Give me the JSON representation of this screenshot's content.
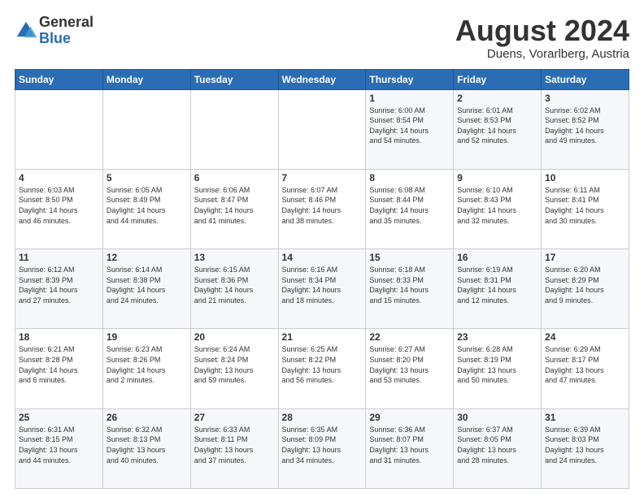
{
  "logo": {
    "general": "General",
    "blue": "Blue"
  },
  "title": "August 2024",
  "location": "Duens, Vorarlberg, Austria",
  "days_of_week": [
    "Sunday",
    "Monday",
    "Tuesday",
    "Wednesday",
    "Thursday",
    "Friday",
    "Saturday"
  ],
  "weeks": [
    [
      {
        "day": "",
        "info": ""
      },
      {
        "day": "",
        "info": ""
      },
      {
        "day": "",
        "info": ""
      },
      {
        "day": "",
        "info": ""
      },
      {
        "day": "1",
        "info": "Sunrise: 6:00 AM\nSunset: 8:54 PM\nDaylight: 14 hours\nand 54 minutes."
      },
      {
        "day": "2",
        "info": "Sunrise: 6:01 AM\nSunset: 8:53 PM\nDaylight: 14 hours\nand 52 minutes."
      },
      {
        "day": "3",
        "info": "Sunrise: 6:02 AM\nSunset: 8:52 PM\nDaylight: 14 hours\nand 49 minutes."
      }
    ],
    [
      {
        "day": "4",
        "info": "Sunrise: 6:03 AM\nSunset: 8:50 PM\nDaylight: 14 hours\nand 46 minutes."
      },
      {
        "day": "5",
        "info": "Sunrise: 6:05 AM\nSunset: 8:49 PM\nDaylight: 14 hours\nand 44 minutes."
      },
      {
        "day": "6",
        "info": "Sunrise: 6:06 AM\nSunset: 8:47 PM\nDaylight: 14 hours\nand 41 minutes."
      },
      {
        "day": "7",
        "info": "Sunrise: 6:07 AM\nSunset: 8:46 PM\nDaylight: 14 hours\nand 38 minutes."
      },
      {
        "day": "8",
        "info": "Sunrise: 6:08 AM\nSunset: 8:44 PM\nDaylight: 14 hours\nand 35 minutes."
      },
      {
        "day": "9",
        "info": "Sunrise: 6:10 AM\nSunset: 8:43 PM\nDaylight: 14 hours\nand 32 minutes."
      },
      {
        "day": "10",
        "info": "Sunrise: 6:11 AM\nSunset: 8:41 PM\nDaylight: 14 hours\nand 30 minutes."
      }
    ],
    [
      {
        "day": "11",
        "info": "Sunrise: 6:12 AM\nSunset: 8:39 PM\nDaylight: 14 hours\nand 27 minutes."
      },
      {
        "day": "12",
        "info": "Sunrise: 6:14 AM\nSunset: 8:38 PM\nDaylight: 14 hours\nand 24 minutes."
      },
      {
        "day": "13",
        "info": "Sunrise: 6:15 AM\nSunset: 8:36 PM\nDaylight: 14 hours\nand 21 minutes."
      },
      {
        "day": "14",
        "info": "Sunrise: 6:16 AM\nSunset: 8:34 PM\nDaylight: 14 hours\nand 18 minutes."
      },
      {
        "day": "15",
        "info": "Sunrise: 6:18 AM\nSunset: 8:33 PM\nDaylight: 14 hours\nand 15 minutes."
      },
      {
        "day": "16",
        "info": "Sunrise: 6:19 AM\nSunset: 8:31 PM\nDaylight: 14 hours\nand 12 minutes."
      },
      {
        "day": "17",
        "info": "Sunrise: 6:20 AM\nSunset: 8:29 PM\nDaylight: 14 hours\nand 9 minutes."
      }
    ],
    [
      {
        "day": "18",
        "info": "Sunrise: 6:21 AM\nSunset: 8:28 PM\nDaylight: 14 hours\nand 6 minutes."
      },
      {
        "day": "19",
        "info": "Sunrise: 6:23 AM\nSunset: 8:26 PM\nDaylight: 14 hours\nand 2 minutes."
      },
      {
        "day": "20",
        "info": "Sunrise: 6:24 AM\nSunset: 8:24 PM\nDaylight: 13 hours\nand 59 minutes."
      },
      {
        "day": "21",
        "info": "Sunrise: 6:25 AM\nSunset: 8:22 PM\nDaylight: 13 hours\nand 56 minutes."
      },
      {
        "day": "22",
        "info": "Sunrise: 6:27 AM\nSunset: 8:20 PM\nDaylight: 13 hours\nand 53 minutes."
      },
      {
        "day": "23",
        "info": "Sunrise: 6:28 AM\nSunset: 8:19 PM\nDaylight: 13 hours\nand 50 minutes."
      },
      {
        "day": "24",
        "info": "Sunrise: 6:29 AM\nSunset: 8:17 PM\nDaylight: 13 hours\nand 47 minutes."
      }
    ],
    [
      {
        "day": "25",
        "info": "Sunrise: 6:31 AM\nSunset: 8:15 PM\nDaylight: 13 hours\nand 44 minutes."
      },
      {
        "day": "26",
        "info": "Sunrise: 6:32 AM\nSunset: 8:13 PM\nDaylight: 13 hours\nand 40 minutes."
      },
      {
        "day": "27",
        "info": "Sunrise: 6:33 AM\nSunset: 8:11 PM\nDaylight: 13 hours\nand 37 minutes."
      },
      {
        "day": "28",
        "info": "Sunrise: 6:35 AM\nSunset: 8:09 PM\nDaylight: 13 hours\nand 34 minutes."
      },
      {
        "day": "29",
        "info": "Sunrise: 6:36 AM\nSunset: 8:07 PM\nDaylight: 13 hours\nand 31 minutes."
      },
      {
        "day": "30",
        "info": "Sunrise: 6:37 AM\nSunset: 8:05 PM\nDaylight: 13 hours\nand 28 minutes."
      },
      {
        "day": "31",
        "info": "Sunrise: 6:39 AM\nSunset: 8:03 PM\nDaylight: 13 hours\nand 24 minutes."
      }
    ]
  ]
}
